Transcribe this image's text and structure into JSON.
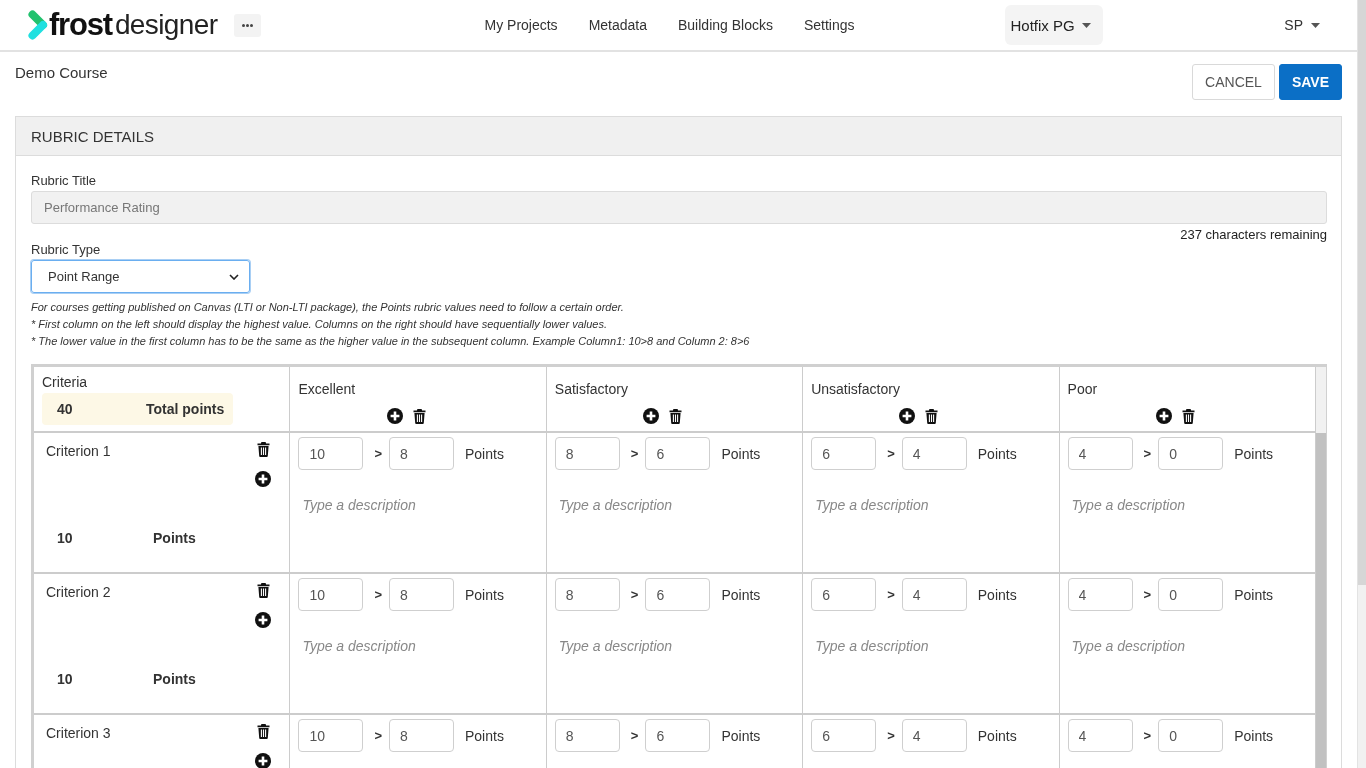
{
  "header": {
    "logo": {
      "bold": "frost",
      "light": "designer"
    },
    "nav": [
      "My Projects",
      "Metadata",
      "Building Blocks",
      "Settings"
    ],
    "workspace": "Hotfix PG",
    "user": "SP"
  },
  "page": {
    "course": "Demo Course",
    "actions": [
      {
        "label": "CANCEL",
        "kind": "secondary"
      },
      {
        "label": "SAVE",
        "kind": "primary"
      }
    ]
  },
  "panel": {
    "title": "RUBRIC DETAILS",
    "rubric_title": {
      "label": "Rubric Title",
      "value": "Performance Rating",
      "disabled": true,
      "counter": "237 characters remaining"
    },
    "rubric_type": {
      "label": "Rubric Type",
      "value": "Point Range",
      "focused": true
    },
    "notes": [
      "For courses getting published on Canvas (LTI or Non-LTI package), the Points rubric values need to follow a certain order.",
      "* First column on the left should display the highest value. Columns on the right should have sequentially lower values.",
      "* The lower value in the first column has to be the same as the higher value in the subsequent column. Example Column1: 10>8 and Column 2: 8>6"
    ],
    "table": {
      "criteria_label": "Criteria",
      "total": {
        "value": "40",
        "label": "Total points"
      },
      "columns": [
        "Excellent",
        "Satisfactory",
        "Unsatisfactory",
        "Poor"
      ],
      "rows": [
        {
          "name": "Criterion 1",
          "points": {
            "value": "10",
            "label": "Points"
          },
          "cells": [
            {
              "high": "10",
              "separator": ">",
              "low": "8",
              "unit": "Points",
              "placeholder": "Type a description"
            },
            {
              "high": "8",
              "separator": ">",
              "low": "6",
              "unit": "Points",
              "placeholder": "Type a description"
            },
            {
              "high": "6",
              "separator": ">",
              "low": "4",
              "unit": "Points",
              "placeholder": "Type a description"
            },
            {
              "high": "4",
              "separator": ">",
              "low": "0",
              "unit": "Points",
              "placeholder": "Type a description"
            }
          ]
        },
        {
          "name": "Criterion 2",
          "points": {
            "value": "10",
            "label": "Points"
          },
          "cells": [
            {
              "high": "10",
              "separator": ">",
              "low": "8",
              "unit": "Points",
              "placeholder": "Type a description"
            },
            {
              "high": "8",
              "separator": ">",
              "low": "6",
              "unit": "Points",
              "placeholder": "Type a description"
            },
            {
              "high": "6",
              "separator": ">",
              "low": "4",
              "unit": "Points",
              "placeholder": "Type a description"
            },
            {
              "high": "4",
              "separator": ">",
              "low": "0",
              "unit": "Points",
              "placeholder": "Type a description"
            }
          ]
        },
        {
          "name": "Criterion 3",
          "cells": [
            {
              "high": "10",
              "separator": ">",
              "low": "8",
              "unit": "Points"
            },
            {
              "high": "8",
              "separator": ">",
              "low": "6",
              "unit": "Points"
            },
            {
              "high": "6",
              "separator": ">",
              "low": "4",
              "unit": "Points"
            },
            {
              "high": "4",
              "separator": ">",
              "low": "0",
              "unit": "Points"
            }
          ]
        }
      ]
    }
  }
}
